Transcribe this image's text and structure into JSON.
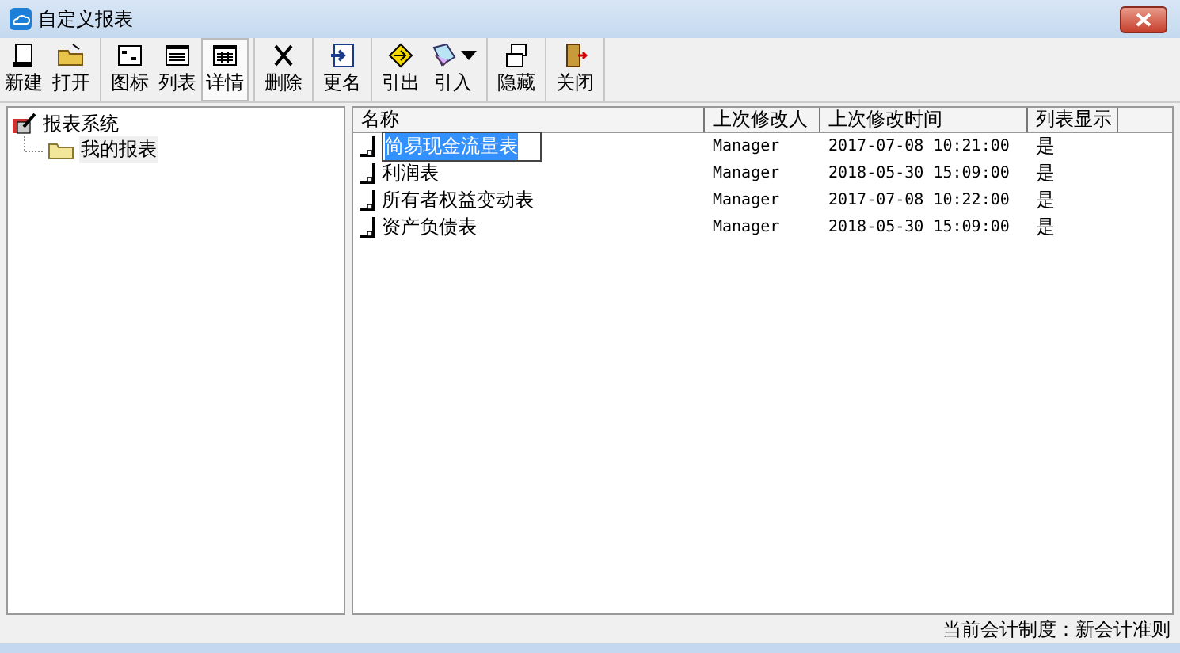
{
  "window": {
    "title": "自定义报表"
  },
  "toolbar": [
    [
      {
        "label": "新建",
        "kind": "new",
        "selected": false,
        "dropdown": false
      },
      {
        "label": "打开",
        "kind": "open",
        "selected": false,
        "dropdown": false
      }
    ],
    [
      {
        "label": "图标",
        "kind": "icons",
        "selected": false,
        "dropdown": false
      },
      {
        "label": "列表",
        "kind": "list",
        "selected": false,
        "dropdown": false
      },
      {
        "label": "详情",
        "kind": "details",
        "selected": true,
        "dropdown": false
      }
    ],
    [
      {
        "label": "删除",
        "kind": "delete",
        "selected": false,
        "dropdown": false
      }
    ],
    [
      {
        "label": "更名",
        "kind": "rename",
        "selected": false,
        "dropdown": false
      }
    ],
    [
      {
        "label": "引出",
        "kind": "export",
        "selected": false,
        "dropdown": false
      },
      {
        "label": "引入",
        "kind": "import",
        "selected": false,
        "dropdown": true
      }
    ],
    [
      {
        "label": "隐藏",
        "kind": "hide",
        "selected": false,
        "dropdown": false
      }
    ],
    [
      {
        "label": "关闭",
        "kind": "close",
        "selected": false,
        "dropdown": false
      }
    ]
  ],
  "tree": {
    "label": "报表系统",
    "expanded": true,
    "children": [
      {
        "label": "我的报表",
        "selected": true
      }
    ]
  },
  "table": {
    "columns": [
      "名称",
      "上次修改人",
      "上次修改时间",
      "列表显示"
    ],
    "rows": [
      {
        "name": "简易现金流量表",
        "modifier": "Manager",
        "time": "2017-07-08 10:21:00",
        "shown": "是",
        "editing": true
      },
      {
        "name": "利润表",
        "modifier": "Manager",
        "time": "2018-05-30 15:09:00",
        "shown": "是",
        "editing": false
      },
      {
        "name": "所有者权益变动表",
        "modifier": "Manager",
        "time": "2017-07-08 10:22:00",
        "shown": "是",
        "editing": false
      },
      {
        "name": "资产负债表",
        "modifier": "Manager",
        "time": "2018-05-30 15:09:00",
        "shown": "是",
        "editing": false
      }
    ]
  },
  "status_bar": "当前会计制度：新会计准则"
}
